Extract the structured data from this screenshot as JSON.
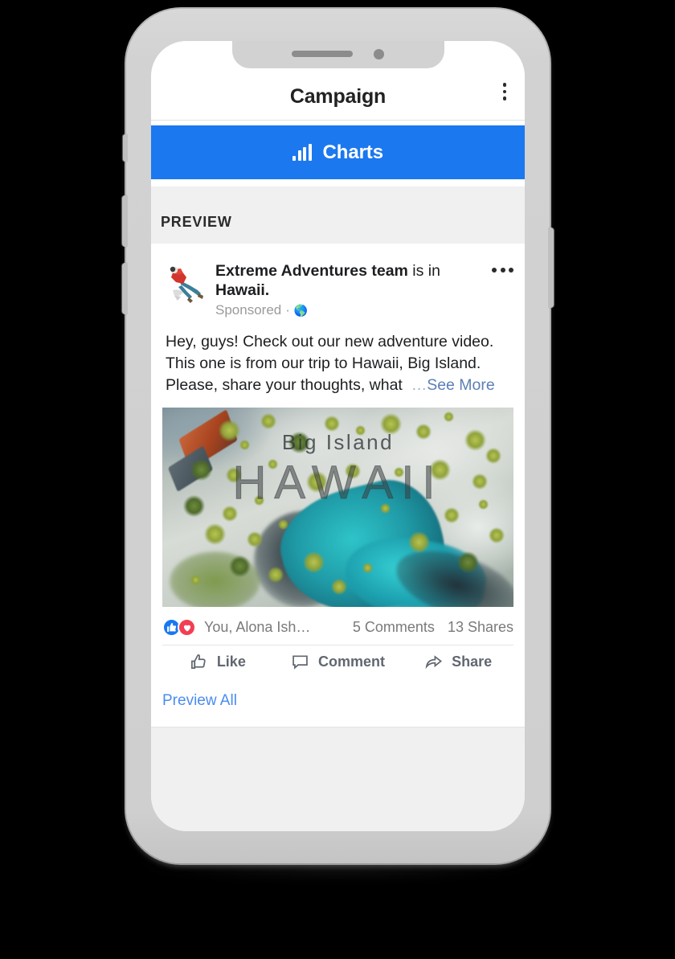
{
  "app": {
    "title": "Campaign",
    "menu_icon": "kebab-menu-icon"
  },
  "charts_button": {
    "label": "Charts",
    "icon": "bar-chart-icon",
    "color": "#1b78ef"
  },
  "preview_section": {
    "label": "PREVIEW"
  },
  "post": {
    "avatar_icon": "skydiver-avatar",
    "author": "Extreme Adventures team",
    "action_text": " is in ",
    "location": "Hawaii.",
    "sponsored_label": "Sponsored",
    "meta_separator": "·",
    "audience_icon": "globe-icon",
    "options_icon": "post-options-dots",
    "body_text": "Hey, guys! Check out our new adventure video. This one is from our trip to Hawaii, Big Island. Please, share your thoughts, what",
    "truncation": "…",
    "see_more_label": "See More",
    "image": {
      "overlay_subtitle": "Big Island",
      "overlay_title": "HAWAII",
      "alt": "aerial view of turquoise lagoon and palm trees"
    },
    "reactions": {
      "like_icon": "thumbs-up-reaction-icon",
      "love_icon": "heart-reaction-icon",
      "names": "You, Alona Ish…",
      "comments": "5 Comments",
      "shares": "13 Shares"
    },
    "actions": [
      {
        "label": "Like",
        "icon": "thumbs-up-icon"
      },
      {
        "label": "Comment",
        "icon": "comment-bubble-icon"
      },
      {
        "label": "Share",
        "icon": "share-arrow-icon"
      }
    ]
  },
  "preview_all": {
    "label": "Preview All",
    "color": "#4a8cf0"
  },
  "device": {
    "notch_speaker": "earpiece-speaker",
    "notch_camera": "front-camera",
    "buttons": [
      "mute-switch",
      "volume-up",
      "volume-down",
      "power"
    ]
  }
}
